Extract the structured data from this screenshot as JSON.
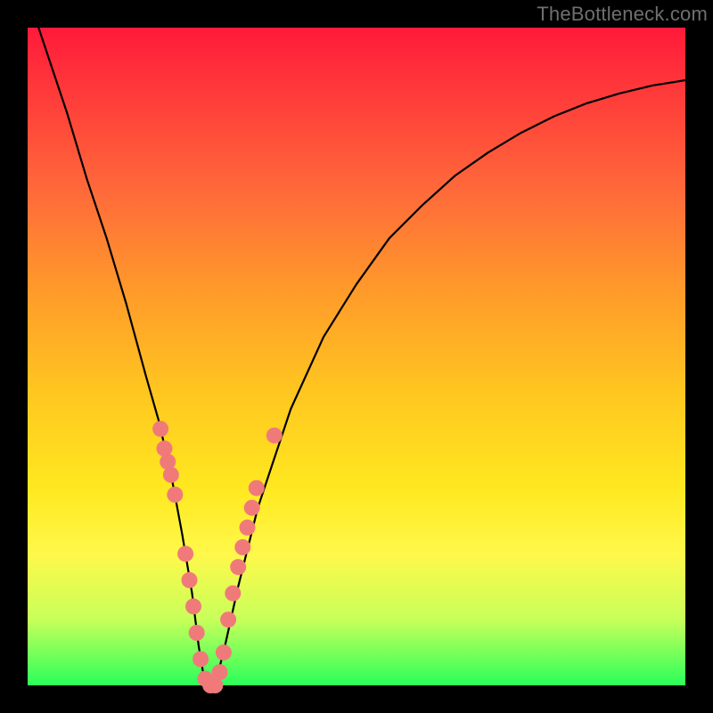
{
  "watermark": "TheBottleneck.com",
  "chart_data": {
    "type": "line",
    "title": "",
    "xlabel": "",
    "ylabel": "",
    "xlim": [
      0,
      100
    ],
    "ylim": [
      0,
      100
    ],
    "series": [
      {
        "name": "bottleneck-curve",
        "x": [
          0,
          3,
          6,
          9,
          12,
          15,
          18,
          20,
          22,
          23.5,
          25,
          26,
          27,
          28.5,
          30,
          32,
          35,
          40,
          45,
          50,
          55,
          60,
          65,
          70,
          75,
          80,
          85,
          90,
          95,
          100
        ],
        "y": [
          105,
          96,
          87,
          77,
          68,
          58,
          47,
          40,
          31,
          23,
          14,
          6,
          0,
          0,
          6,
          15,
          27,
          42,
          53,
          61,
          68,
          73,
          77.5,
          81,
          84,
          86.5,
          88.5,
          90,
          91.2,
          92
        ]
      }
    ],
    "markers": {
      "name": "sample-points",
      "color": "#f07a7a",
      "points": [
        {
          "x": 20.2,
          "y": 39
        },
        {
          "x": 20.8,
          "y": 36
        },
        {
          "x": 21.3,
          "y": 34
        },
        {
          "x": 21.8,
          "y": 32
        },
        {
          "x": 22.4,
          "y": 29
        },
        {
          "x": 24.0,
          "y": 20
        },
        {
          "x": 24.6,
          "y": 16
        },
        {
          "x": 25.2,
          "y": 12
        },
        {
          "x": 25.7,
          "y": 8
        },
        {
          "x": 26.3,
          "y": 4
        },
        {
          "x": 27.0,
          "y": 1
        },
        {
          "x": 27.8,
          "y": 0
        },
        {
          "x": 28.5,
          "y": 0
        },
        {
          "x": 29.2,
          "y": 2
        },
        {
          "x": 29.8,
          "y": 5
        },
        {
          "x": 30.5,
          "y": 10
        },
        {
          "x": 31.2,
          "y": 14
        },
        {
          "x": 32.0,
          "y": 18
        },
        {
          "x": 32.7,
          "y": 21
        },
        {
          "x": 33.4,
          "y": 24
        },
        {
          "x": 34.1,
          "y": 27
        },
        {
          "x": 34.8,
          "y": 30
        },
        {
          "x": 37.5,
          "y": 38
        }
      ]
    }
  }
}
